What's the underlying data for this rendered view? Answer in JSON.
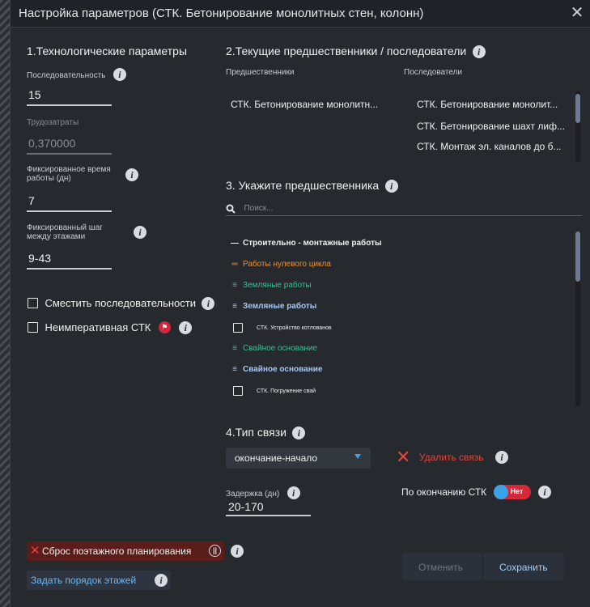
{
  "window": {
    "title": "Настройка параметров (СТК. Бетонирование монолитных стен, колонн)",
    "close_icon": "close-icon"
  },
  "tech": {
    "heading": "1.Технологические параметры",
    "sequence": {
      "label": "Последовательность",
      "value": "15"
    },
    "labor": {
      "label": "Трудозатраты",
      "value": "0,370000"
    },
    "fixed_time": {
      "label_l1": "Фиксированное время",
      "label_l2": "работы (дн)",
      "value": "7"
    },
    "fixed_step": {
      "label_l1": "Фиксированный шаг",
      "label_l2": "между этажами",
      "value": "9-43"
    },
    "shift_seq": {
      "label": "Сместить последовательности",
      "checked": false
    },
    "nonimperative": {
      "label": "Неимперативная СТК",
      "checked": false
    }
  },
  "current": {
    "heading": "2.Текущие предшественники / последователи",
    "predecessors_header": "Предшественники",
    "successors_header": "Последователи",
    "predecessors": [
      "СТК. Бетонирование монолитн..."
    ],
    "successors": [
      "СТК. Бетонирование монолит...",
      "СТК. Бетонирование шахт лиф...",
      "СТК. Монтаж эл. каналов до б..."
    ]
  },
  "choose": {
    "heading": "3. Укажите предшественника",
    "search_placeholder": "Поиск...",
    "tree": [
      {
        "icon": "—",
        "label": "Строительно - монтажные работы",
        "color": "#f0f0f0",
        "bold": true,
        "indent": 0,
        "type": "group"
      },
      {
        "icon": "═",
        "label": "Работы нулевого цикла",
        "color": "#e8923a",
        "bold": false,
        "indent": 0,
        "type": "group"
      },
      {
        "icon": "≡",
        "label": "Земляные работы",
        "color": "#3fbf94",
        "bold": false,
        "indent": 0,
        "type": "group"
      },
      {
        "icon": "≡",
        "label": "Земляные работы",
        "color": "#a8c7f0",
        "bold": true,
        "indent": 0,
        "type": "group"
      },
      {
        "icon": "",
        "label": "СТК. Устройство котлованов",
        "color": "#f0f0f0",
        "bold": false,
        "indent": 1,
        "type": "check"
      },
      {
        "icon": "≡",
        "label": "Свайное основание",
        "color": "#3fbf94",
        "bold": false,
        "indent": 0,
        "type": "group"
      },
      {
        "icon": "≡",
        "label": "Свайное основание",
        "color": "#a8c7f0",
        "bold": true,
        "indent": 0,
        "type": "group"
      },
      {
        "icon": "",
        "label": "СТК. Погружение свай",
        "color": "#f0f0f0",
        "bold": false,
        "indent": 1,
        "type": "check"
      }
    ]
  },
  "link": {
    "heading": "4.Тип связи",
    "type_value": "окончание-начало",
    "delete_label": "Удалить связь",
    "delay_label": "Задержка (дн)",
    "delay_value": "20-170",
    "on_finish_label": "По окончанию СТК",
    "on_finish_toggle": "Нет"
  },
  "actions": {
    "reset_label": "Сброс поэтажного планирования",
    "floor_order_label": "Задать порядок этажей",
    "cancel_label": "Отменить",
    "save_label": "Сохранить"
  },
  "colors": {
    "accent_blue": "#3aa3e8",
    "danger_red": "#e0463c",
    "dialog_bg": "#26292e"
  }
}
